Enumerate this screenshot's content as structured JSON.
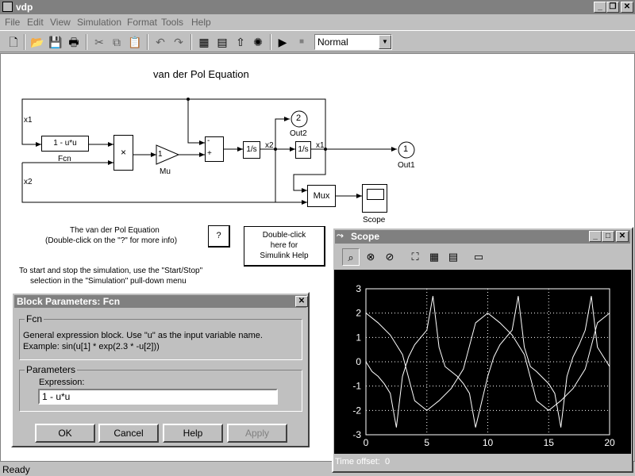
{
  "window": {
    "title": "vdp",
    "icon": "simulink-model-icon"
  },
  "menu": [
    "File",
    "Edit",
    "View",
    "Simulation",
    "Format",
    "Tools",
    "Help"
  ],
  "toolbar": {
    "icons": [
      "new-icon",
      "open-icon",
      "save-icon",
      "print-icon",
      "cut-icon",
      "copy-icon",
      "paste-icon",
      "undo-icon",
      "redo-icon",
      "library-browser-icon",
      "toggle-model-browser-icon",
      "go-to-parent-icon",
      "debug-icon",
      "start-icon",
      "stop-icon"
    ],
    "sim_mode": "Normal"
  },
  "diagram": {
    "title": "van der Pol Equation",
    "signals": {
      "x1": "x1",
      "x2": "x2"
    },
    "blocks": {
      "fcn": {
        "text": "1 - u*u",
        "label": "Fcn"
      },
      "product": {
        "text": "×"
      },
      "gain": {
        "text": "1",
        "label": "Mu"
      },
      "sum": {
        "plus": "+",
        "minus": "-"
      },
      "int1": {
        "text": "1/s"
      },
      "int2": {
        "text": "1/s"
      },
      "out1": {
        "text": "1",
        "label": "Out1"
      },
      "out2": {
        "text": "2",
        "label": "Out2"
      },
      "mux": {
        "text": "Mux"
      },
      "scope": {
        "label": "Scope"
      }
    },
    "info_line1": "The van der Pol Equation",
    "info_line2": "(Double-click on the \"?\" for more info)",
    "help_q": "?",
    "help_box": [
      "Double-click",
      "here for",
      "Simulink Help"
    ],
    "start_stop_line1": "To start and stop the simulation, use the \"Start/Stop\"",
    "start_stop_line2": "selection in the \"Simulation\" pull-down menu"
  },
  "status": "Ready",
  "dialog": {
    "title": "Block Parameters: Fcn",
    "group1_label": "Fcn",
    "desc_line1": "General expression block. Use \"u\" as the input variable name.",
    "desc_line2": "Example: sin(u[1] * exp(2.3 * -u[2]))",
    "group2_label": "Parameters",
    "expression_label": "Expression:",
    "expression_value": "1 - u*u",
    "buttons": {
      "ok": "OK",
      "cancel": "Cancel",
      "help": "Help",
      "apply": "Apply"
    }
  },
  "scope": {
    "title": "Scope",
    "toolbar_icons": [
      "zoom-icon",
      "zoom-x-icon",
      "zoom-y-icon",
      "autoscale-icon",
      "save-axes-icon",
      "restore-axes-icon",
      "properties-icon"
    ],
    "time_offset_label": "Time offset:",
    "time_offset_value": "0"
  },
  "chart_data": {
    "type": "line",
    "xlim": [
      0,
      20
    ],
    "ylim": [
      -3,
      3
    ],
    "xticks": [
      0,
      5,
      10,
      15,
      20
    ],
    "yticks": [
      -3,
      -2,
      -1,
      0,
      1,
      2,
      3
    ],
    "grid": true,
    "series": [
      {
        "color": "#ffffff",
        "x": [
          0,
          1,
          2,
          3,
          4,
          5,
          6,
          7,
          8,
          9,
          10,
          11,
          12,
          13,
          14,
          15,
          16,
          17,
          18,
          19,
          20
        ],
        "y": [
          2,
          1.6,
          1.1,
          0.3,
          -1.6,
          -2,
          -1.6,
          -1.1,
          -0.3,
          1.6,
          2,
          1.6,
          1.1,
          0.3,
          -1.6,
          -2,
          -1.6,
          -1.1,
          -0.3,
          1.6,
          2
        ]
      },
      {
        "color": "#ffffff",
        "x": [
          0,
          0.5,
          1,
          1.5,
          2,
          2.5,
          3,
          3.5,
          4,
          5,
          5.5,
          6,
          6.5,
          7,
          7.5,
          8,
          8.5,
          9,
          10,
          10.5,
          11,
          11.5,
          12,
          12.5,
          13,
          13.5,
          14,
          15,
          15.5,
          16,
          16.5,
          17,
          17.5,
          18,
          18.5,
          19,
          20
        ],
        "y": [
          0,
          -0.4,
          -0.6,
          -0.9,
          -1.3,
          -2.7,
          -0.6,
          0.2,
          0.7,
          1.3,
          2.7,
          0.6,
          -0.2,
          -0.4,
          -0.6,
          -0.9,
          -1.3,
          -2.7,
          -0.6,
          0.2,
          0.7,
          1.0,
          1.3,
          2.7,
          0.6,
          -0.2,
          -0.4,
          -0.9,
          -1.3,
          -2.7,
          -0.6,
          0.2,
          0.7,
          1.3,
          2.7,
          0.6,
          -0.2
        ]
      }
    ]
  }
}
